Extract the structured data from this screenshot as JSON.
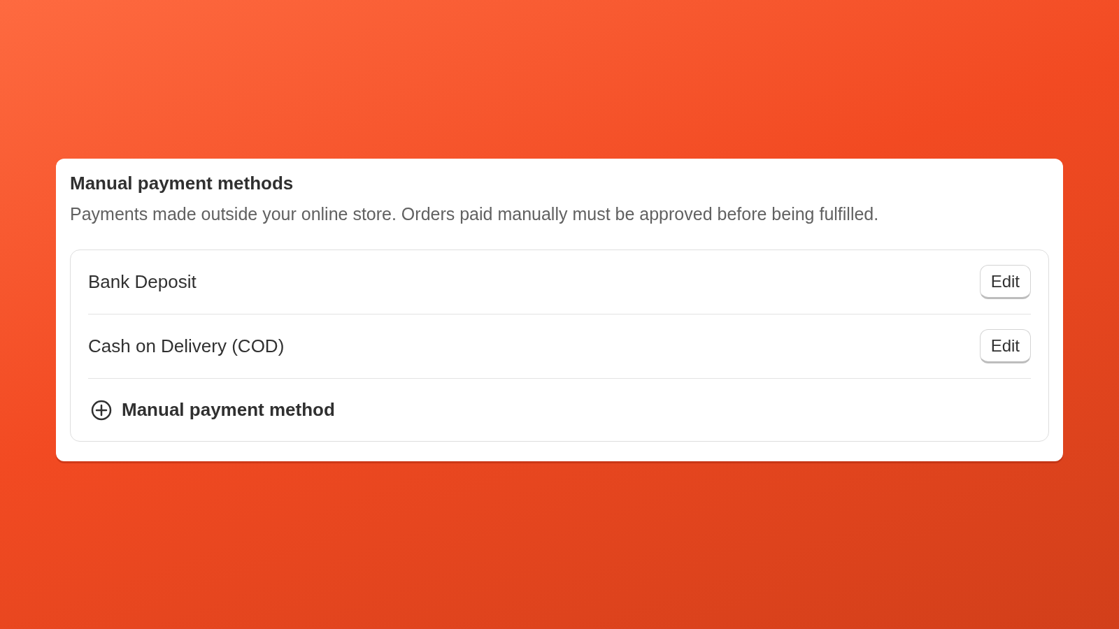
{
  "card": {
    "title": "Manual payment methods",
    "description": "Payments made outside your online store. Orders paid manually must be approved before being fulfilled.",
    "methods": [
      {
        "name": "Bank Deposit",
        "action": "Edit"
      },
      {
        "name": "Cash on Delivery (COD)",
        "action": "Edit"
      }
    ],
    "add_button": "Manual payment method"
  }
}
